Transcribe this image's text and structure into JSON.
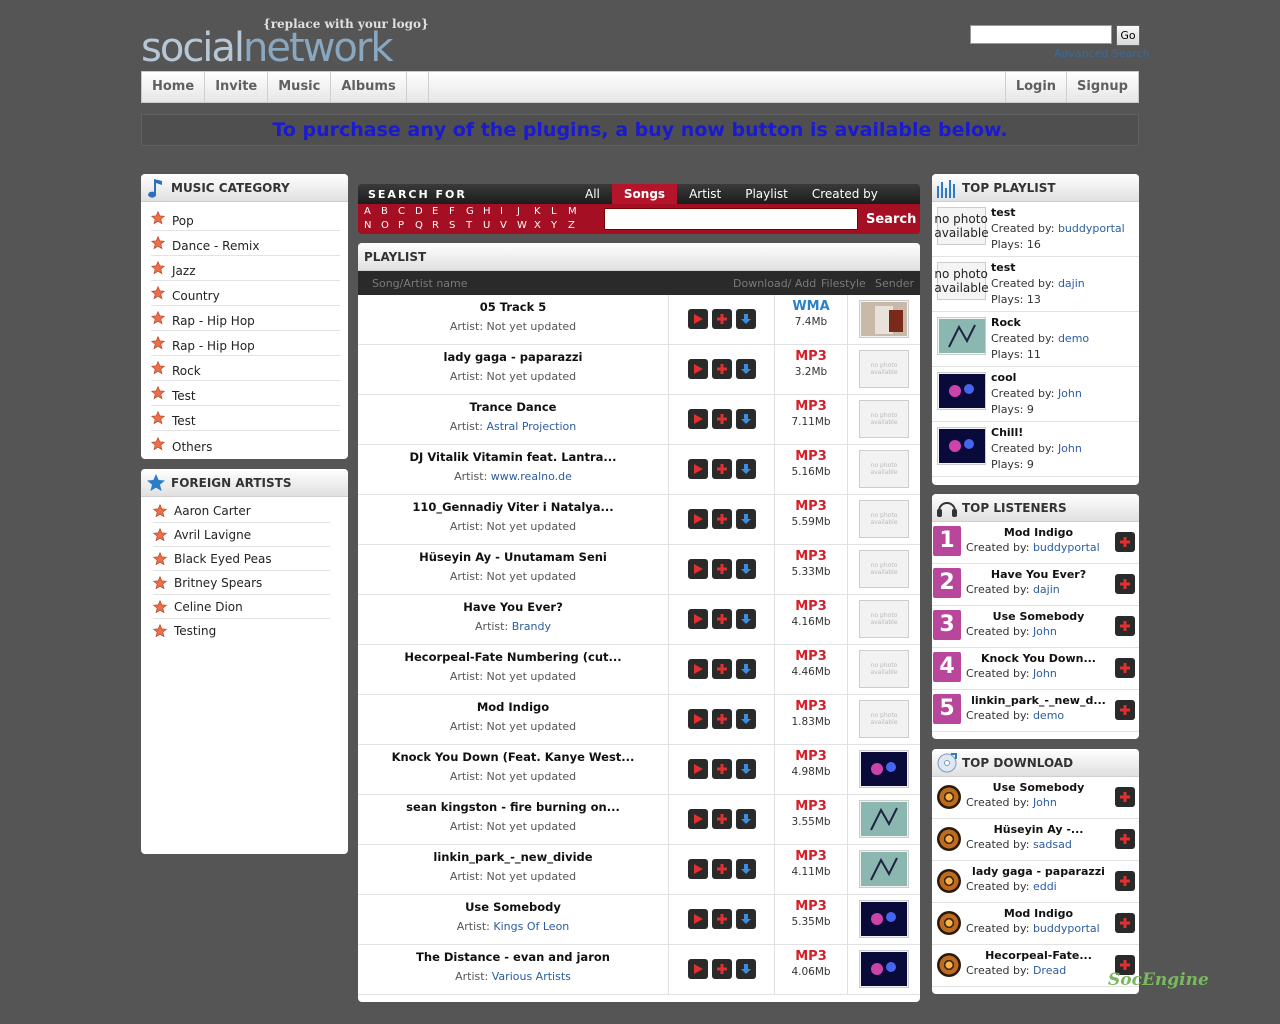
{
  "header": {
    "logo_tagline": "{replace with your logo}",
    "logo_part1": "social",
    "logo_part2": "network",
    "search_placeholder": "",
    "go_label": "Go",
    "advanced_search": "Advanced Search"
  },
  "nav": {
    "left": [
      "Home",
      "Invite",
      "Music",
      "Albums"
    ],
    "right": [
      "Login",
      "Signup"
    ]
  },
  "promo_text": "To purchase any of the plugins, a buy now button is available below.",
  "music_category": {
    "title": "MUSIC CATEGORY",
    "items": [
      "Pop",
      "Dance - Remix",
      "Jazz",
      "Country",
      "Rap - Hip Hop",
      "Rap - Hip Hop",
      "Rock",
      "Test",
      "Test",
      "Others"
    ]
  },
  "foreign_artists": {
    "title": "FOREIGN ARTISTS",
    "items": [
      "Aaron Carter",
      "Avril Lavigne",
      "Black Eyed Peas",
      "Britney Spears",
      "Celine Dion",
      "Testing"
    ]
  },
  "search_music": {
    "label": "SEARCH FOR",
    "tabs": [
      "All",
      "Songs",
      "Artist",
      "Playlist",
      "Created by"
    ],
    "active_tab": "Songs",
    "letters_row1": [
      "A",
      "B",
      "C",
      "D",
      "E",
      "F",
      "G",
      "H",
      "I",
      "J",
      "K",
      "L",
      "M"
    ],
    "letters_row2": [
      "N",
      "O",
      "P",
      "Q",
      "R",
      "S",
      "T",
      "U",
      "V",
      "W",
      "X",
      "Y",
      "Z"
    ],
    "button": "Search"
  },
  "playlist": {
    "title": "PLAYLIST",
    "columns": {
      "song": "Song/Artist name",
      "download": "Download/ Add",
      "filestyle": "Filestyle",
      "sender": "Sender"
    },
    "artist_prefix": "Artist:",
    "no_photo": "no photo available",
    "rows": [
      {
        "title": "05 Track 5",
        "artist": "Not yet updated",
        "artist_link": false,
        "type": "WMA",
        "size": "7.4Mb",
        "thumb": "photo"
      },
      {
        "title": "lady gaga - paparazzi",
        "artist": "Not yet updated",
        "artist_link": false,
        "type": "MP3",
        "size": "3.2Mb",
        "thumb": "none"
      },
      {
        "title": "Trance Dance",
        "artist": "Astral Projection",
        "artist_link": true,
        "type": "MP3",
        "size": "7.11Mb",
        "thumb": "none"
      },
      {
        "title": "DJ Vitalik Vitamin feat. Lantra...",
        "artist": "www.realno.de",
        "artist_link": true,
        "type": "MP3",
        "size": "5.16Mb",
        "thumb": "none"
      },
      {
        "title": "110_Gennadiy Viter i Natalya...",
        "artist": "Not yet updated",
        "artist_link": false,
        "type": "MP3",
        "size": "5.59Mb",
        "thumb": "none"
      },
      {
        "title": "Hüseyin Ay - Unutamam Seni",
        "artist": "Not yet updated",
        "artist_link": false,
        "type": "MP3",
        "size": "5.33Mb",
        "thumb": "none"
      },
      {
        "title": "Have You Ever?",
        "artist": "Brandy",
        "artist_link": true,
        "type": "MP3",
        "size": "4.16Mb",
        "thumb": "none"
      },
      {
        "title": "Hecorpeal-Fate Numbering (cut...",
        "artist": "Not yet updated",
        "artist_link": false,
        "type": "MP3",
        "size": "4.46Mb",
        "thumb": "none"
      },
      {
        "title": "Mod Indigo",
        "artist": "Not yet updated",
        "artist_link": false,
        "type": "MP3",
        "size": "1.83Mb",
        "thumb": "none"
      },
      {
        "title": "Knock You Down (Feat. Kanye West...",
        "artist": "Not yet updated",
        "artist_link": false,
        "type": "MP3",
        "size": "4.98Mb",
        "thumb": "dark"
      },
      {
        "title": "sean kingston - fire burning on...",
        "artist": "Not yet updated",
        "artist_link": false,
        "type": "MP3",
        "size": "3.55Mb",
        "thumb": "teal"
      },
      {
        "title": "linkin_park_-_new_divide",
        "artist": "Not yet updated",
        "artist_link": false,
        "type": "MP3",
        "size": "4.11Mb",
        "thumb": "teal"
      },
      {
        "title": "Use Somebody",
        "artist": "Kings Of Leon",
        "artist_link": true,
        "type": "MP3",
        "size": "5.35Mb",
        "thumb": "dark"
      },
      {
        "title": "The Distance - evan and jaron",
        "artist": "Various Artists",
        "artist_link": true,
        "type": "MP3",
        "size": "4.06Mb",
        "thumb": "dark"
      }
    ]
  },
  "top_playlist": {
    "title": "TOP PLAYLIST",
    "created_prefix": "Created by:",
    "plays_prefix": "Plays:",
    "items": [
      {
        "title": "test",
        "creator": "buddyportal",
        "plays": "16",
        "thumb": "none"
      },
      {
        "title": "test",
        "creator": "dajin",
        "plays": "13",
        "thumb": "none"
      },
      {
        "title": "Rock",
        "creator": "demo",
        "plays": "11",
        "thumb": "teal"
      },
      {
        "title": "cool",
        "creator": "John",
        "plays": "9",
        "thumb": "dark"
      },
      {
        "title": "Chill!",
        "creator": "John",
        "plays": "9",
        "thumb": "dark"
      }
    ]
  },
  "top_listeners": {
    "title": "TOP LISTENERS",
    "created_prefix": "Created by:",
    "items": [
      {
        "rank": "1",
        "title": "Mod Indigo",
        "creator": "buddyportal"
      },
      {
        "rank": "2",
        "title": "Have You Ever?",
        "creator": "dajin"
      },
      {
        "rank": "3",
        "title": "Use Somebody",
        "creator": "John"
      },
      {
        "rank": "4",
        "title": "Knock You Down...",
        "creator": "John"
      },
      {
        "rank": "5",
        "title": "linkin_park_-_new_d...",
        "creator": "demo"
      }
    ]
  },
  "top_download": {
    "title": "TOP DOWNLOAD",
    "created_prefix": "Created by:",
    "items": [
      {
        "title": "Use Somebody",
        "creator": "John"
      },
      {
        "title": "Hüseyin Ay -...",
        "creator": "sadsad"
      },
      {
        "title": "lady gaga - paparazzi",
        "creator": "eddi"
      },
      {
        "title": "Mod Indigo",
        "creator": "buddyportal"
      },
      {
        "title": "Hecorpeal-Fate...",
        "creator": "Dread"
      }
    ]
  },
  "watermark": "SocEngine",
  "colors": {
    "mp3": "#d21f2a",
    "wma": "#2c7fc9",
    "link": "#2a5d9f",
    "active_tab": "#b5152b",
    "rank_badge": "#b8479b"
  }
}
